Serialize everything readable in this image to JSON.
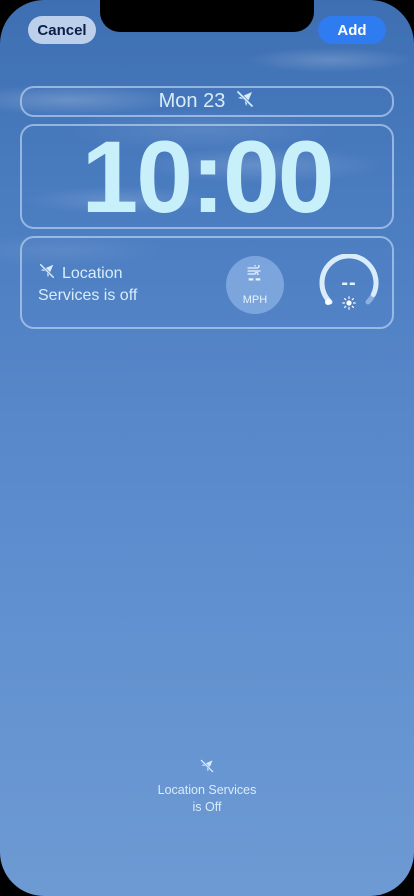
{
  "toolbar": {
    "cancel_label": "Cancel",
    "add_label": "Add"
  },
  "lock_screen": {
    "date": "Mon 23",
    "time": "10:00"
  },
  "widgets": {
    "location": {
      "line1": "Location",
      "line2": "Services is off"
    },
    "wind": {
      "value": "--",
      "unit": "MPH"
    },
    "uv_gauge": {
      "value": "--"
    }
  },
  "footer_note": {
    "line1": "Location Services",
    "line2": "is Off"
  },
  "icons": {
    "location_off": "location-slash-icon",
    "wind": "wind-icon",
    "sun": "sun-icon"
  },
  "colors": {
    "accent": "#2f7bf0",
    "time_text": "#c8f0fb",
    "label_text": "#d8ecfa"
  }
}
